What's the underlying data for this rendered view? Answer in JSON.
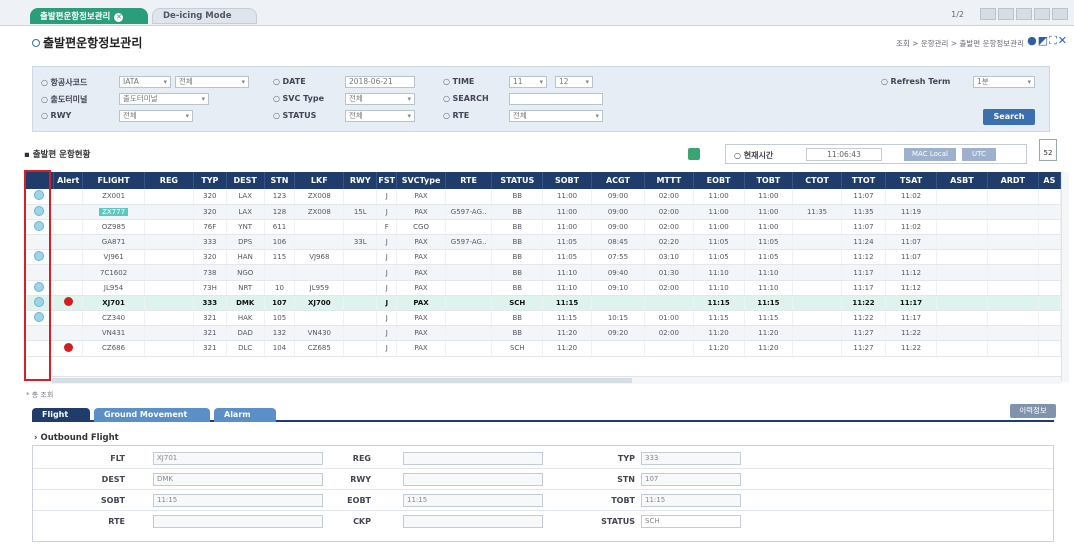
{
  "tabs": [
    {
      "label": "출발편운항정보관리"
    },
    {
      "label": "De-icing Mode"
    }
  ],
  "page_num": "1/2",
  "page_title": "출발편운항정보관리",
  "breadcrumb": "조회 > 운항관리 > 출발편 운항정보관리",
  "filters": {
    "airline_code": {
      "label": "항공사코드",
      "type": "IATA",
      "value": "전체"
    },
    "terminal": {
      "label": "출도터미널",
      "value": "출도터미널"
    },
    "rwy": {
      "label": "RWY",
      "value": "전체"
    },
    "date": {
      "label": "DATE",
      "value": "2018-06-21"
    },
    "svc_type": {
      "label": "SVC Type",
      "value": "전체"
    },
    "status": {
      "label": "STATUS",
      "value": "전체"
    },
    "time": {
      "label": "TIME",
      "from": "11",
      "to": "12"
    },
    "search": {
      "label": "SEARCH",
      "value": ""
    },
    "rte": {
      "label": "RTE",
      "value": "전체"
    },
    "refresh": {
      "label": "Refresh Term",
      "value": "1분"
    },
    "search_button": "Search"
  },
  "section_title": "출발편 운항현황",
  "current_time": {
    "label": "현재시간",
    "value": "11:06:43",
    "btn_local": "MAC Local",
    "btn_utc": "UTC"
  },
  "calendar_label": "52",
  "columns": [
    "",
    "Alert",
    "FLIGHT",
    "REG",
    "TYP",
    "DEST",
    "STN",
    "LKF",
    "RWY",
    "FST",
    "SVCType",
    "RTE",
    "STATUS",
    "SOBT",
    "ACGT",
    "MTTT",
    "EOBT",
    "TOBT",
    "CTOT",
    "TTOT",
    "TSAT",
    "ASBT",
    "ARDT",
    "AS"
  ],
  "rows": [
    {
      "radio": true,
      "alert": false,
      "flight": "ZX001",
      "reg": "",
      "typ": "320",
      "dest": "LAX",
      "stn": "123",
      "lkf": "ZX008",
      "rwy": "",
      "fst": "J",
      "svc": "PAX",
      "rte": "",
      "status": "BB",
      "sobt": "11:00",
      "acgt": "09:00",
      "mttt": "02:00",
      "eobt": "11:00",
      "tobt": "11:00",
      "ctot": "",
      "ttot": "11:07",
      "tsat": "11:02"
    },
    {
      "radio": true,
      "alert": false,
      "flight": "ZX777",
      "reg": "",
      "typ": "320",
      "dest": "LAX",
      "stn": "128",
      "lkf": "ZX008",
      "rwy": "15L",
      "fst": "J",
      "svc": "PAX",
      "rte": "G597-AG..",
      "status": "BB",
      "sobt": "11:00",
      "acgt": "09:00",
      "mttt": "02:00",
      "eobt": "11:00",
      "tobt": "11:00",
      "ctot": "11:35",
      "ttot": "11:35",
      "tsat": "11:19"
    },
    {
      "radio": true,
      "alert": false,
      "flight": "OZ985",
      "reg": "",
      "typ": "76F",
      "dest": "YNT",
      "stn": "611",
      "lkf": "",
      "rwy": "",
      "fst": "F",
      "svc": "CGO",
      "rte": "",
      "status": "BB",
      "sobt": "11:00",
      "acgt": "09:00",
      "mttt": "02:00",
      "eobt": "11:00",
      "tobt": "11:00",
      "ctot": "",
      "ttot": "11:07",
      "tsat": "11:02"
    },
    {
      "radio": false,
      "alert": false,
      "flight": "GA871",
      "reg": "",
      "typ": "333",
      "dest": "DPS",
      "stn": "106",
      "lkf": "",
      "rwy": "33L",
      "fst": "J",
      "svc": "PAX",
      "rte": "G597-AG..",
      "status": "BB",
      "sobt": "11:05",
      "acgt": "08:45",
      "mttt": "02:20",
      "eobt": "11:05",
      "tobt": "11:05",
      "ctot": "",
      "ttot": "11:24",
      "tsat": "11:07"
    },
    {
      "radio": true,
      "alert": false,
      "flight": "VJ961",
      "reg": "",
      "typ": "320",
      "dest": "HAN",
      "stn": "115",
      "lkf": "VJ968",
      "rwy": "",
      "fst": "J",
      "svc": "PAX",
      "rte": "",
      "status": "BB",
      "sobt": "11:05",
      "acgt": "07:55",
      "mttt": "03:10",
      "eobt": "11:05",
      "tobt": "11:05",
      "ctot": "",
      "ttot": "11:12",
      "tsat": "11:07"
    },
    {
      "radio": false,
      "alert": false,
      "flight": "7C1602",
      "reg": "",
      "typ": "738",
      "dest": "NGO",
      "stn": "",
      "lkf": "",
      "rwy": "",
      "fst": "J",
      "svc": "PAX",
      "rte": "",
      "status": "BB",
      "sobt": "11:10",
      "acgt": "09:40",
      "mttt": "01:30",
      "eobt": "11:10",
      "tobt": "11:10",
      "ctot": "",
      "ttot": "11:17",
      "tsat": "11:12"
    },
    {
      "radio": true,
      "alert": false,
      "flight": "JL954",
      "reg": "",
      "typ": "73H",
      "dest": "NRT",
      "stn": "10",
      "lkf": "JL959",
      "rwy": "",
      "fst": "J",
      "svc": "PAX",
      "rte": "",
      "status": "BB",
      "sobt": "11:10",
      "acgt": "09:10",
      "mttt": "02:00",
      "eobt": "11:10",
      "tobt": "11:10",
      "ctot": "",
      "ttot": "11:17",
      "tsat": "11:12"
    },
    {
      "radio": true,
      "alert": true,
      "flight": "XJ701",
      "reg": "",
      "typ": "333",
      "dest": "DMK",
      "stn": "107",
      "lkf": "XJ700",
      "rwy": "",
      "fst": "J",
      "svc": "PAX",
      "rte": "",
      "status": "SCH",
      "sobt": "11:15",
      "acgt": "",
      "mttt": "",
      "eobt": "11:15",
      "tobt": "11:15",
      "ctot": "",
      "ttot": "11:22",
      "tsat": "11:17",
      "selected": true
    },
    {
      "radio": true,
      "alert": false,
      "flight": "CZ340",
      "reg": "",
      "typ": "321",
      "dest": "HAK",
      "stn": "105",
      "lkf": "",
      "rwy": "",
      "fst": "J",
      "svc": "PAX",
      "rte": "",
      "status": "BB",
      "sobt": "11:15",
      "acgt": "10:15",
      "mttt": "01:00",
      "eobt": "11:15",
      "tobt": "11:15",
      "ctot": "",
      "ttot": "11:22",
      "tsat": "11:17"
    },
    {
      "radio": false,
      "alert": false,
      "flight": "VN431",
      "reg": "",
      "typ": "321",
      "dest": "DAD",
      "stn": "132",
      "lkf": "VN430",
      "rwy": "",
      "fst": "J",
      "svc": "PAX",
      "rte": "",
      "status": "BB",
      "sobt": "11:20",
      "acgt": "09:20",
      "mttt": "02:00",
      "eobt": "11:20",
      "tobt": "11:20",
      "ctot": "",
      "ttot": "11:27",
      "tsat": "11:22"
    },
    {
      "radio": false,
      "alert": true,
      "flight": "CZ686",
      "reg": "",
      "typ": "321",
      "dest": "DLC",
      "stn": "104",
      "lkf": "CZ685",
      "rwy": "",
      "fst": "J",
      "svc": "PAX",
      "rte": "",
      "status": "SCH",
      "sobt": "11:20",
      "acgt": "",
      "mttt": "",
      "eobt": "11:20",
      "tobt": "11:20",
      "ctot": "",
      "ttot": "11:27",
      "tsat": "11:22"
    }
  ],
  "note": "* 총 조회",
  "bottom_tabs": [
    "Flight",
    "Ground Movement",
    "Alarm"
  ],
  "bottom_button": "이력정보",
  "outbound_title": "Outbound Flight",
  "detail": {
    "FLT": "XJ701",
    "REG": "",
    "TYP": "333",
    "DEST": "DMK",
    "RWY": "",
    "STN": "107",
    "SOBT": "11:15",
    "EOBT": "11:15",
    "TOBT": "11:15",
    "RTE": "",
    "CKP": "",
    "STATUS": "SCH"
  },
  "colors": {
    "header": "#1f3c6b",
    "accent": "#2a9d7a",
    "alert": "#d21e1e",
    "highlight": "#d61f26"
  }
}
